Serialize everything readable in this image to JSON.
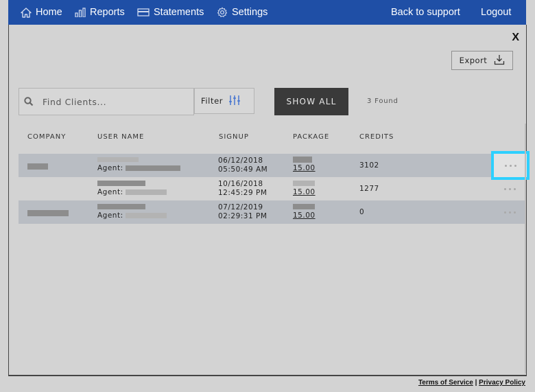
{
  "nav": {
    "home": "Home",
    "reports": "Reports",
    "statements": "Statements",
    "settings": "Settings",
    "back_to_support": "Back to support",
    "logout": "Logout"
  },
  "panel": {
    "close_label": "X",
    "export_label": "Export",
    "search_placeholder": "Find Clients...",
    "filter_label": "Filter",
    "show_all_label": "SHOW ALL",
    "found_count": "3 Found"
  },
  "table": {
    "columns": [
      "COMPANY",
      "USER NAME",
      "SIGNUP",
      "PACKAGE",
      "CREDITS"
    ],
    "rows": [
      {
        "agent_label": "Agent:",
        "signup_date": "06/12/2018",
        "signup_time": "05:50:49 AM",
        "package_price": "15.00",
        "credits": "3102"
      },
      {
        "agent_label": "Agent:",
        "signup_date": "10/16/2018",
        "signup_time": "12:45:29 PM",
        "package_price": "15.00",
        "credits": "1277"
      },
      {
        "agent_label": "Agent:",
        "signup_date": "07/12/2019",
        "signup_time": "02:29:31 PM",
        "package_price": "15.00",
        "credits": "0"
      }
    ]
  },
  "footer": {
    "terms": "Terms of Service",
    "separator": "|",
    "privacy": "Privacy Policy"
  },
  "colors": {
    "nav_bg": "#1f4fa6",
    "highlight": "#2ed0ff",
    "row_shade": "#b9bdc3",
    "show_all_bg": "#3a3a3a"
  },
  "icons": [
    "home-icon",
    "bar-chart-icon",
    "card-icon",
    "gear-icon",
    "search-icon",
    "sliders-icon",
    "download-icon",
    "more-icon"
  ]
}
